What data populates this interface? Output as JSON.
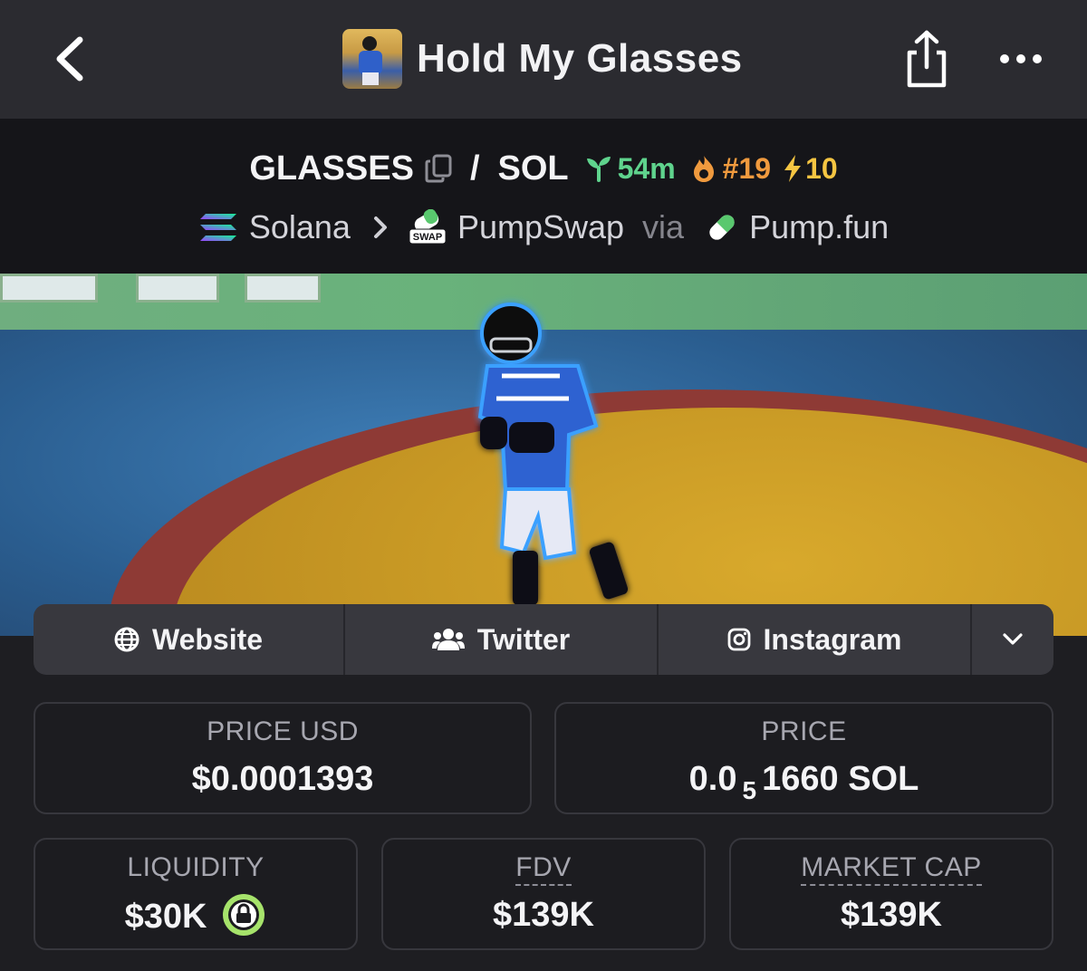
{
  "header": {
    "title": "Hold My Glasses"
  },
  "pair": {
    "base": "GLASSES",
    "slash": "/",
    "quote": "SOL",
    "age": "54m",
    "trending": "#19",
    "boosts": "10"
  },
  "chain": {
    "network": "Solana",
    "dex": "PumpSwap",
    "via": "via",
    "launchpad": "Pump.fun",
    "swap_badge": "SWAP"
  },
  "links": {
    "website": "Website",
    "twitter": "Twitter",
    "instagram": "Instagram"
  },
  "stats": {
    "price_usd_label": "PRICE USD",
    "price_usd_value": "$0.0001393",
    "price_label": "PRICE",
    "price_prefix": "0.0",
    "price_zeros": "5",
    "price_digits": "1660",
    "price_unit": "SOL",
    "liquidity_label": "LIQUIDITY",
    "liquidity_value": "$30K",
    "fdv_label": "FDV",
    "fdv_value": "$139K",
    "mcap_label": "MARKET CAP",
    "mcap_value": "$139K"
  },
  "colors": {
    "age": "#5fd38d",
    "trending": "#f09a3e",
    "boost": "#f5c542",
    "lock": "#a6e36b"
  }
}
